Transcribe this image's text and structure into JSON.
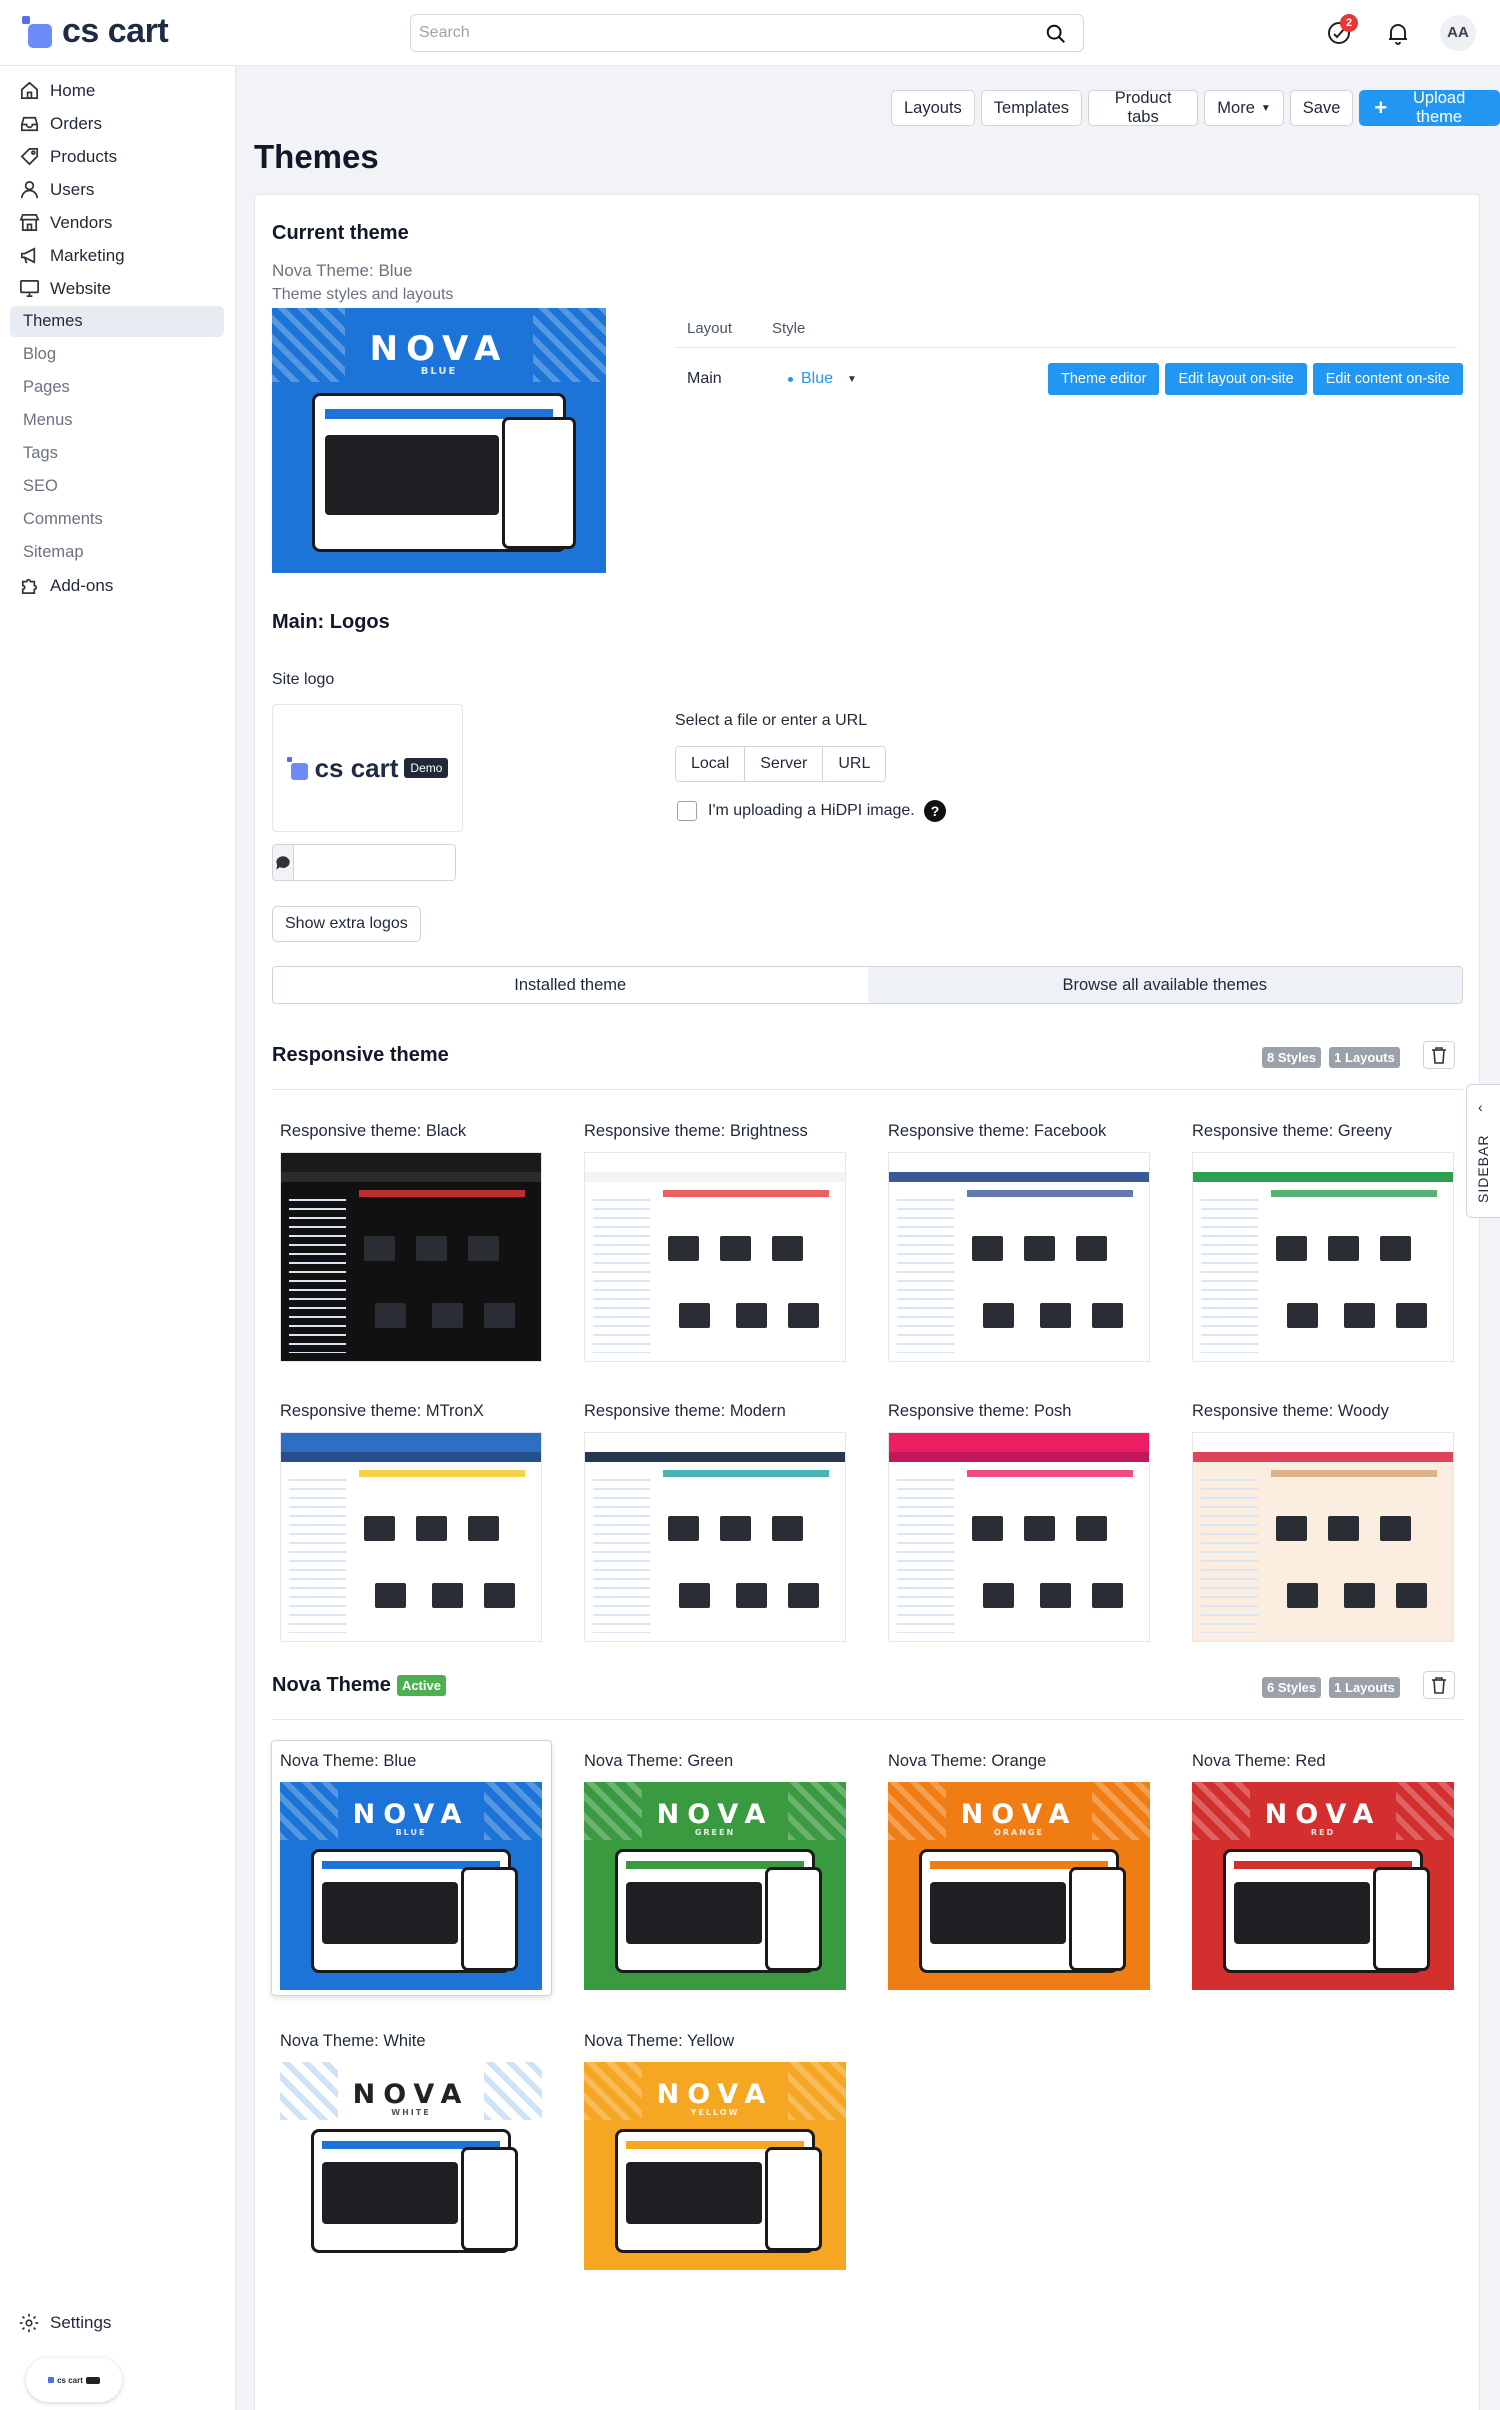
{
  "header": {
    "logo_text": "cs cart",
    "search_placeholder": "Search",
    "notifications_count": "2",
    "avatar_initials": "AA"
  },
  "sidebar": {
    "items": [
      {
        "label": "Home",
        "icon": "home-icon"
      },
      {
        "label": "Orders",
        "icon": "inbox-icon"
      },
      {
        "label": "Products",
        "icon": "tag-icon"
      },
      {
        "label": "Users",
        "icon": "user-icon"
      },
      {
        "label": "Vendors",
        "icon": "storefront-icon"
      },
      {
        "label": "Marketing",
        "icon": "megaphone-icon"
      },
      {
        "label": "Website",
        "icon": "monitor-icon"
      }
    ],
    "website_sub": [
      "Themes",
      "Blog",
      "Pages",
      "Menus",
      "Tags",
      "SEO",
      "Comments",
      "Sitemap"
    ],
    "addons_label": "Add-ons",
    "settings_label": "Settings",
    "mini_logo_text": "cs cart"
  },
  "toolbar": {
    "layouts": "Layouts",
    "templates": "Templates",
    "product_tabs": "Product tabs",
    "more": "More",
    "save": "Save",
    "upload_theme": "Upload theme"
  },
  "page": {
    "title": "Themes"
  },
  "current_theme": {
    "heading": "Current theme",
    "name": "Nova Theme: Blue",
    "desc": "Theme styles and layouts",
    "col_layout": "Layout",
    "col_style": "Style",
    "layout_value": "Main",
    "style_value": "Blue",
    "btn_theme_editor": "Theme editor",
    "btn_edit_layout": "Edit layout on-site",
    "btn_edit_content": "Edit content on-site"
  },
  "logos": {
    "heading": "Main: Logos",
    "site_logo_label": "Site logo",
    "logo_text": "cs cart",
    "demo_badge": "Demo",
    "select_label": "Select a file or enter a URL",
    "source_options": [
      "Local",
      "Server",
      "URL"
    ],
    "hidpi_label": "I'm uploading a HiDPI image.",
    "alt_value": "",
    "show_extra": "Show extra logos"
  },
  "tabs": {
    "installed": "Installed theme",
    "browse": "Browse all available themes"
  },
  "responsive": {
    "heading": "Responsive theme",
    "styles_pill": "8 Styles",
    "layouts_pill": "1 Layouts",
    "themes": [
      {
        "name": "Responsive theme: Black",
        "header": "#1a1a1a",
        "nav": "#2b2b2b",
        "accent": "#e53935",
        "bg": "#111111"
      },
      {
        "name": "Responsive theme: Brightness",
        "header": "#ffffff",
        "nav": "#f3f4f6",
        "accent": "#e53935",
        "bg": "#ffffff"
      },
      {
        "name": "Responsive theme: Facebook",
        "header": "#ffffff",
        "nav": "#3b5998",
        "accent": "#3b5998",
        "bg": "#ffffff"
      },
      {
        "name": "Responsive theme: Greeny",
        "header": "#ffffff",
        "nav": "#2e9e4f",
        "accent": "#2e9e4f",
        "bg": "#ffffff"
      },
      {
        "name": "Responsive theme: MTronX",
        "header": "#2f6fc3",
        "nav": "#244f8a",
        "accent": "#f5c518",
        "bg": "#ffffff"
      },
      {
        "name": "Responsive theme: Modern",
        "header": "#ffffff",
        "nav": "#27374d",
        "accent": "#1aa3a3",
        "bg": "#ffffff"
      },
      {
        "name": "Responsive theme: Posh",
        "header": "#e91e63",
        "nav": "#c2185b",
        "accent": "#e91e63",
        "bg": "#ffffff"
      },
      {
        "name": "Responsive theme: Woody",
        "header": "#ffffff",
        "nav": "#e0445a",
        "accent": "#d4a373",
        "bg": "#fbeee0"
      }
    ]
  },
  "nova": {
    "heading": "Nova Theme",
    "active_badge": "Active",
    "styles_pill": "6 Styles",
    "layouts_pill": "1 Layouts",
    "brand_text": "NOVA",
    "themes": [
      {
        "name": "Nova Theme: Blue",
        "variant": "BLUE",
        "color": "#1d74d8"
      },
      {
        "name": "Nova Theme: Green",
        "variant": "GREEN",
        "color": "#3a9a3f"
      },
      {
        "name": "Nova Theme: Orange",
        "variant": "ORANGE",
        "color": "#f07d14"
      },
      {
        "name": "Nova Theme: Red",
        "variant": "RED",
        "color": "#d32f2f"
      },
      {
        "name": "Nova Theme: White",
        "variant": "WHITE",
        "color": "#ffffff"
      },
      {
        "name": "Nova Theme: Yellow",
        "variant": "YELLOW",
        "color": "#f5a623"
      }
    ]
  },
  "sidebar_toggle": {
    "label": "SIDEBAR"
  }
}
